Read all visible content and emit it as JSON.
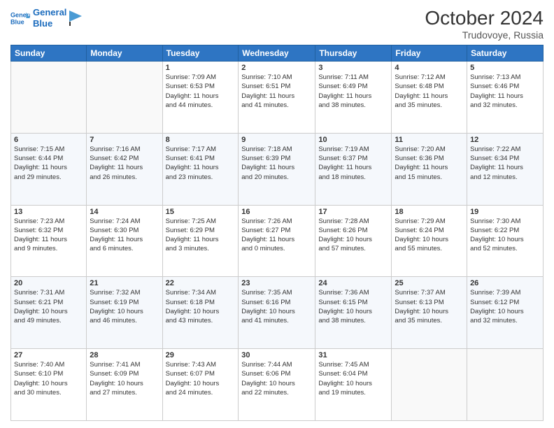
{
  "header": {
    "logo_line1": "General",
    "logo_line2": "Blue",
    "month_title": "October 2024",
    "location": "Trudovoye, Russia"
  },
  "weekdays": [
    "Sunday",
    "Monday",
    "Tuesday",
    "Wednesday",
    "Thursday",
    "Friday",
    "Saturday"
  ],
  "weeks": [
    [
      {
        "day": "",
        "content": ""
      },
      {
        "day": "",
        "content": ""
      },
      {
        "day": "1",
        "content": "Sunrise: 7:09 AM\nSunset: 6:53 PM\nDaylight: 11 hours\nand 44 minutes."
      },
      {
        "day": "2",
        "content": "Sunrise: 7:10 AM\nSunset: 6:51 PM\nDaylight: 11 hours\nand 41 minutes."
      },
      {
        "day": "3",
        "content": "Sunrise: 7:11 AM\nSunset: 6:49 PM\nDaylight: 11 hours\nand 38 minutes."
      },
      {
        "day": "4",
        "content": "Sunrise: 7:12 AM\nSunset: 6:48 PM\nDaylight: 11 hours\nand 35 minutes."
      },
      {
        "day": "5",
        "content": "Sunrise: 7:13 AM\nSunset: 6:46 PM\nDaylight: 11 hours\nand 32 minutes."
      }
    ],
    [
      {
        "day": "6",
        "content": "Sunrise: 7:15 AM\nSunset: 6:44 PM\nDaylight: 11 hours\nand 29 minutes."
      },
      {
        "day": "7",
        "content": "Sunrise: 7:16 AM\nSunset: 6:42 PM\nDaylight: 11 hours\nand 26 minutes."
      },
      {
        "day": "8",
        "content": "Sunrise: 7:17 AM\nSunset: 6:41 PM\nDaylight: 11 hours\nand 23 minutes."
      },
      {
        "day": "9",
        "content": "Sunrise: 7:18 AM\nSunset: 6:39 PM\nDaylight: 11 hours\nand 20 minutes."
      },
      {
        "day": "10",
        "content": "Sunrise: 7:19 AM\nSunset: 6:37 PM\nDaylight: 11 hours\nand 18 minutes."
      },
      {
        "day": "11",
        "content": "Sunrise: 7:20 AM\nSunset: 6:36 PM\nDaylight: 11 hours\nand 15 minutes."
      },
      {
        "day": "12",
        "content": "Sunrise: 7:22 AM\nSunset: 6:34 PM\nDaylight: 11 hours\nand 12 minutes."
      }
    ],
    [
      {
        "day": "13",
        "content": "Sunrise: 7:23 AM\nSunset: 6:32 PM\nDaylight: 11 hours\nand 9 minutes."
      },
      {
        "day": "14",
        "content": "Sunrise: 7:24 AM\nSunset: 6:30 PM\nDaylight: 11 hours\nand 6 minutes."
      },
      {
        "day": "15",
        "content": "Sunrise: 7:25 AM\nSunset: 6:29 PM\nDaylight: 11 hours\nand 3 minutes."
      },
      {
        "day": "16",
        "content": "Sunrise: 7:26 AM\nSunset: 6:27 PM\nDaylight: 11 hours\nand 0 minutes."
      },
      {
        "day": "17",
        "content": "Sunrise: 7:28 AM\nSunset: 6:26 PM\nDaylight: 10 hours\nand 57 minutes."
      },
      {
        "day": "18",
        "content": "Sunrise: 7:29 AM\nSunset: 6:24 PM\nDaylight: 10 hours\nand 55 minutes."
      },
      {
        "day": "19",
        "content": "Sunrise: 7:30 AM\nSunset: 6:22 PM\nDaylight: 10 hours\nand 52 minutes."
      }
    ],
    [
      {
        "day": "20",
        "content": "Sunrise: 7:31 AM\nSunset: 6:21 PM\nDaylight: 10 hours\nand 49 minutes."
      },
      {
        "day": "21",
        "content": "Sunrise: 7:32 AM\nSunset: 6:19 PM\nDaylight: 10 hours\nand 46 minutes."
      },
      {
        "day": "22",
        "content": "Sunrise: 7:34 AM\nSunset: 6:18 PM\nDaylight: 10 hours\nand 43 minutes."
      },
      {
        "day": "23",
        "content": "Sunrise: 7:35 AM\nSunset: 6:16 PM\nDaylight: 10 hours\nand 41 minutes."
      },
      {
        "day": "24",
        "content": "Sunrise: 7:36 AM\nSunset: 6:15 PM\nDaylight: 10 hours\nand 38 minutes."
      },
      {
        "day": "25",
        "content": "Sunrise: 7:37 AM\nSunset: 6:13 PM\nDaylight: 10 hours\nand 35 minutes."
      },
      {
        "day": "26",
        "content": "Sunrise: 7:39 AM\nSunset: 6:12 PM\nDaylight: 10 hours\nand 32 minutes."
      }
    ],
    [
      {
        "day": "27",
        "content": "Sunrise: 7:40 AM\nSunset: 6:10 PM\nDaylight: 10 hours\nand 30 minutes."
      },
      {
        "day": "28",
        "content": "Sunrise: 7:41 AM\nSunset: 6:09 PM\nDaylight: 10 hours\nand 27 minutes."
      },
      {
        "day": "29",
        "content": "Sunrise: 7:43 AM\nSunset: 6:07 PM\nDaylight: 10 hours\nand 24 minutes."
      },
      {
        "day": "30",
        "content": "Sunrise: 7:44 AM\nSunset: 6:06 PM\nDaylight: 10 hours\nand 22 minutes."
      },
      {
        "day": "31",
        "content": "Sunrise: 7:45 AM\nSunset: 6:04 PM\nDaylight: 10 hours\nand 19 minutes."
      },
      {
        "day": "",
        "content": ""
      },
      {
        "day": "",
        "content": ""
      }
    ]
  ]
}
